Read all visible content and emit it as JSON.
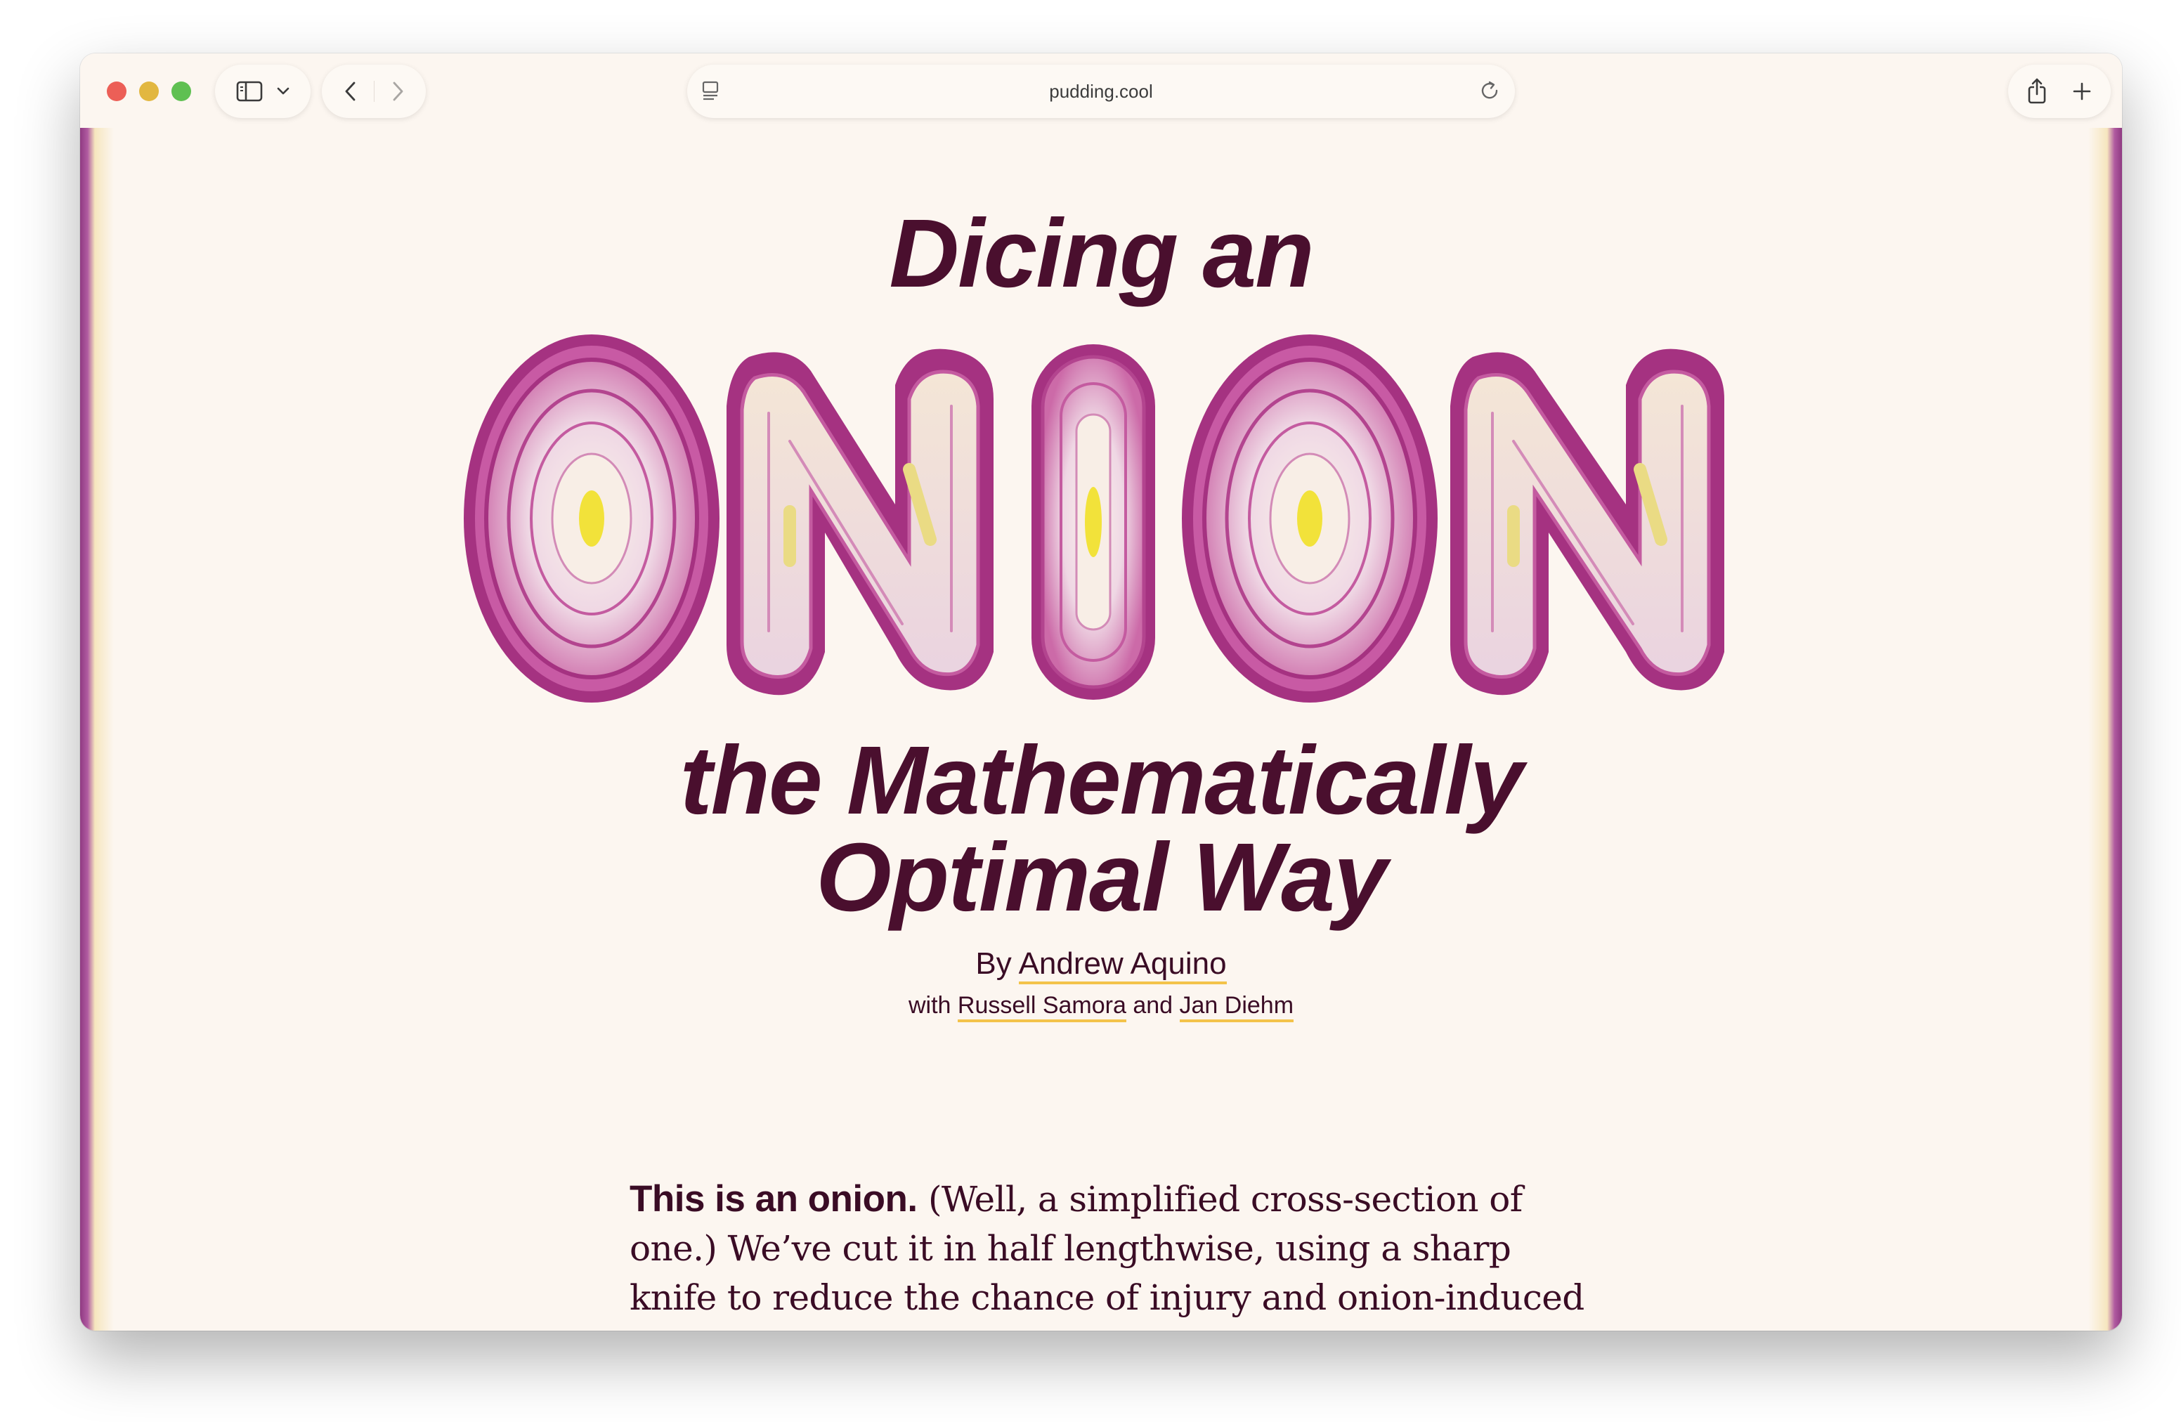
{
  "browser": {
    "url": "pudding.cool",
    "icons": [
      "sidebar-icon",
      "chevron-down-icon",
      "back-arrow-icon",
      "forward-arrow-icon",
      "page-icon",
      "reload-icon",
      "share-icon",
      "plus-icon"
    ]
  },
  "article": {
    "title_top": "Dicing an",
    "title_image_word": "ONION",
    "title_bottom_line1": "the Mathematically",
    "title_bottom_line2": "Optimal Way",
    "by_prefix": "By",
    "author": "Andrew Aquino",
    "with_prefix": "with",
    "coauthor1": "Russell Samora",
    "and": "and",
    "coauthor2": "Jan Diehm",
    "intro_lead": "This is an onion.",
    "intro_body": "(Well, a simplified cross-section of one.) We’ve cut it in half lengthwise, using a sharp knife to reduce the chance of injury and onion-induced crying."
  },
  "colors": {
    "page_bg": "#fcf6f0",
    "title": "#4a0f2e",
    "text": "#3a0c25",
    "link_underline": "#f3c34a",
    "onion_purple": "#b03c8c",
    "onion_light": "#f6e9ef",
    "onion_core": "#f2e23a"
  }
}
